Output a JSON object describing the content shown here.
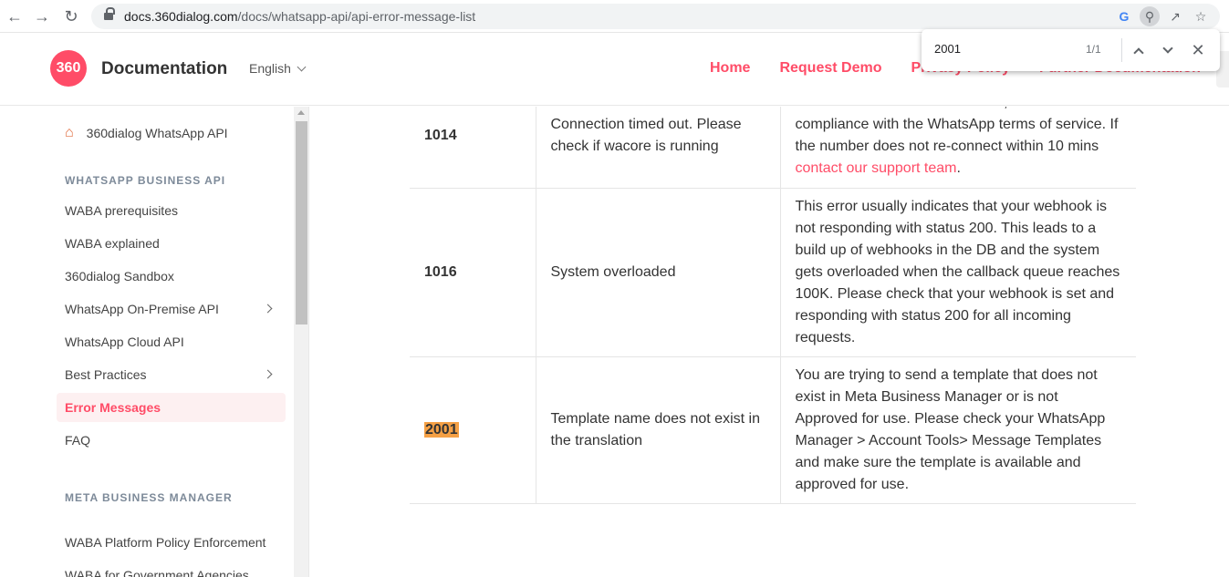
{
  "browser": {
    "url_domain": "docs.360dialog.com",
    "url_path": "/docs/whatsapp-api/api-error-message-list",
    "icons": [
      "back-arrow-icon",
      "forward-arrow-icon",
      "reload-icon",
      "lock-icon",
      "google-icon",
      "find-icon",
      "share-icon",
      "star-icon"
    ]
  },
  "find": {
    "query": "2001",
    "count": "1/1"
  },
  "header": {
    "logo_text": "360",
    "title": "Documentation",
    "language": "English",
    "links": [
      "Home",
      "Request Demo",
      "Privacy Policy",
      "Further Documentation"
    ]
  },
  "sidebar": {
    "home": "360dialog WhatsApp API",
    "section1": "WHATSAPP BUSINESS API",
    "items": [
      {
        "label": "WABA prerequisites"
      },
      {
        "label": "WABA explained"
      },
      {
        "label": "360dialog Sandbox"
      },
      {
        "label": "WhatsApp On-Premise API"
      },
      {
        "label": "WhatsApp Cloud API"
      },
      {
        "label": "Best Practices"
      },
      {
        "label": "Error Messages"
      },
      {
        "label": "FAQ"
      }
    ],
    "section2": "META BUSINESS MANAGER",
    "items2": [
      {
        "label": "WABA Platform Policy Enforcement"
      },
      {
        "label": "WABA for Government Agencies"
      }
    ]
  },
  "table": {
    "rows": [
      {
        "code": "1014",
        "message": "Connection timed out. Please check if wacore is running",
        "description": "reasons such as a server restart, or due to non-compliance with the WhatsApp terms of service. If the number does not re-connect within 10 mins",
        "link": "contact our support team",
        "tail": "."
      },
      {
        "code": "1016",
        "message": "System overloaded",
        "description": "This error usually indicates that your webhook is not responding with status 200. This leads to a build up of webhooks in the DB and the system gets overloaded when the callback queue reaches 100K. Please check that your webhook is set and responding with status 200 for all incoming requests."
      },
      {
        "code": "2001",
        "message": "Template name does not exist in the translation",
        "description": "You are trying to send a template that does not exist in Meta Business Manager or is not Approved for use. Please check your WhatsApp Manager > Account Tools> Message Templates and make sure the template is available and approved for use."
      }
    ]
  },
  "colors": {
    "brand": "#ff4c67",
    "highlight": "#f5a045"
  }
}
